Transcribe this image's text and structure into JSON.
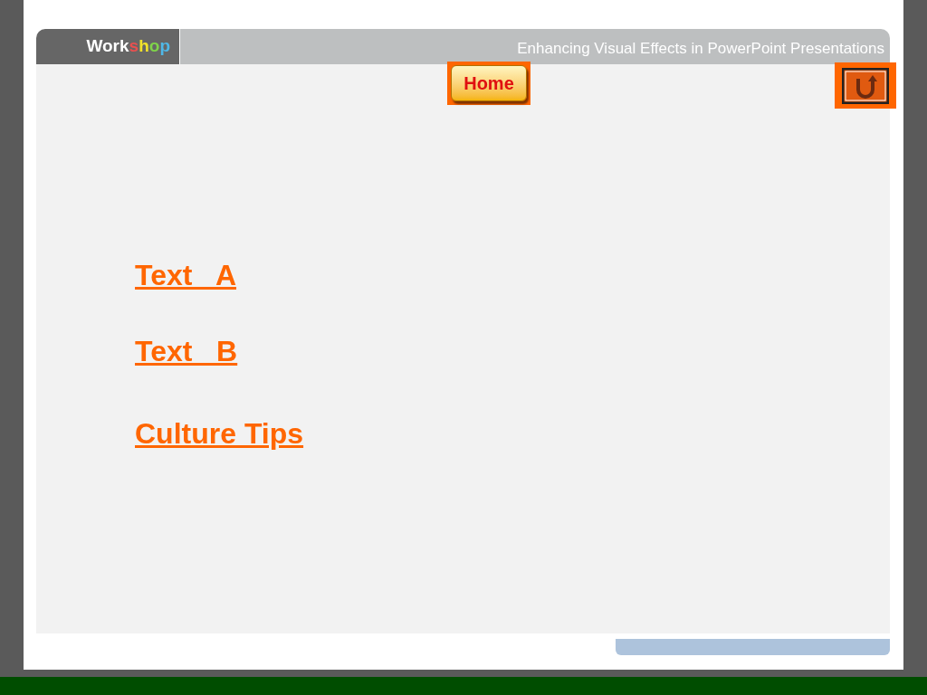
{
  "header": {
    "logo": [
      {
        "text": "Work",
        "color": "#ffffff"
      },
      {
        "text": "s",
        "color": "#e8504f"
      },
      {
        "text": "h",
        "color": "#f2e22a"
      },
      {
        "text": "o",
        "color": "#7fd34a"
      },
      {
        "text": "p",
        "color": "#4fb8e8"
      }
    ],
    "title": "Enhancing Visual Effects in PowerPoint Presentations"
  },
  "home_button": {
    "label": "Home"
  },
  "links": [
    {
      "label": "Text   A"
    },
    {
      "label": "Text   B"
    },
    {
      "label": "Culture Tips"
    }
  ]
}
